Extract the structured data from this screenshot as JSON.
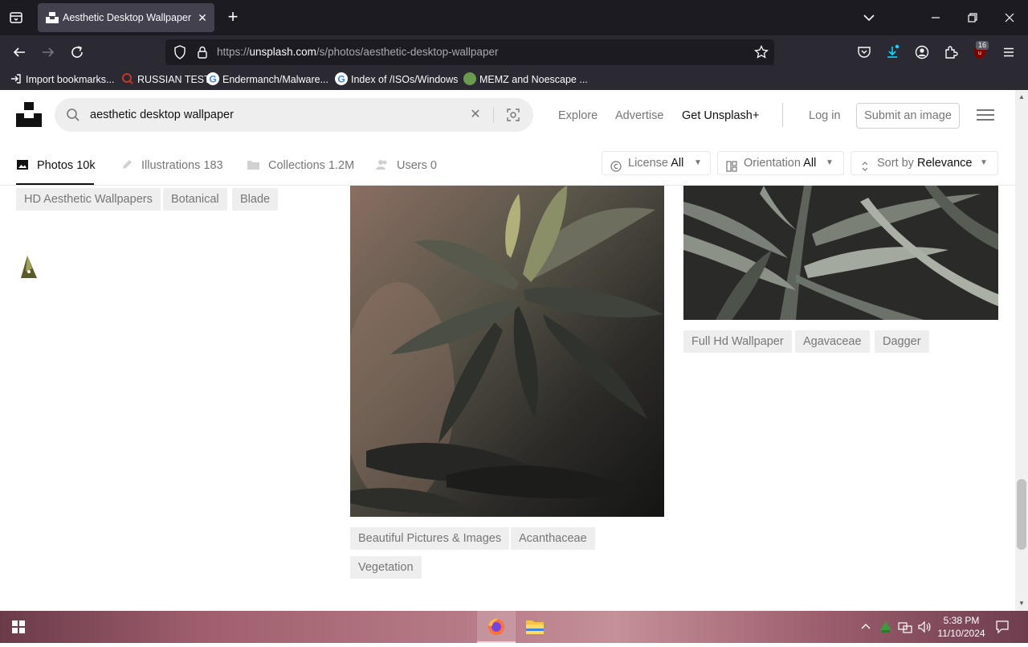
{
  "browser": {
    "tab": {
      "title": "Aesthetic Desktop Wallpaper Pi",
      "close": "✕"
    },
    "new_tab": "+",
    "window_controls": {
      "list": "⌄",
      "minimize": "—",
      "restore": "❐",
      "close": "✕"
    },
    "url_prefix": "https://",
    "url_host": "unsplash.com",
    "url_path": "/s/photos/aesthetic-desktop-wallpaper",
    "extension_badge": "16",
    "bookmarks": [
      {
        "label": "Import bookmarks...",
        "icon": "import-icon",
        "color": "#fbfbfe"
      },
      {
        "label": "RUSSIAN TEST",
        "icon": "search-engine-icon",
        "color": "#c0392b"
      },
      {
        "label": "Endermanch/Malware...",
        "icon": "google-icon",
        "color": "#4285f4"
      },
      {
        "label": "Index of /ISOs/Windows",
        "icon": "google-icon",
        "color": "#4285f4"
      },
      {
        "label": "MEMZ and Noescape ...",
        "icon": "site-icon",
        "color": "#6a9a4e"
      }
    ]
  },
  "page": {
    "search_value": "aesthetic desktop wallpaper",
    "search_clear": "✕",
    "nav": {
      "explore": "Explore",
      "advertise": "Advertise",
      "get_plus": "Get Unsplash+",
      "login": "Log in",
      "submit": "Submit an image"
    },
    "filter_tabs": [
      {
        "label": "Photos",
        "count": "10k",
        "active": true
      },
      {
        "label": "Illustrations",
        "count": "183",
        "active": false
      },
      {
        "label": "Collections",
        "count": "1.2M",
        "active": false
      },
      {
        "label": "Users",
        "count": "0",
        "active": false
      }
    ],
    "filters": {
      "license_label": "License",
      "license_value": "All",
      "orientation_label": "Orientation",
      "orientation_value": "All",
      "sort_label": "Sort by",
      "sort_value": "Relevance"
    },
    "col1_tags": [
      "HD Aesthetic Wallpapers",
      "Botanical",
      "Blade"
    ],
    "col2_tags": [
      "Beautiful Pictures & Images",
      "Acanthaceae",
      "Vegetation"
    ],
    "col3_tags": [
      "Full Hd Wallpaper",
      "Agavaceae",
      "Dagger"
    ]
  },
  "taskbar": {
    "clock_time": "5:38 PM",
    "clock_date": "11/10/2024",
    "tray_chevron": "^"
  },
  "colors": {
    "accent": "#111111",
    "tag_bg": "#eeeeee",
    "muted": "#767676",
    "firefox_tab_bg": "#42414d",
    "toolbar_bg": "#2b2a33",
    "download_accent": "#00ddff"
  }
}
